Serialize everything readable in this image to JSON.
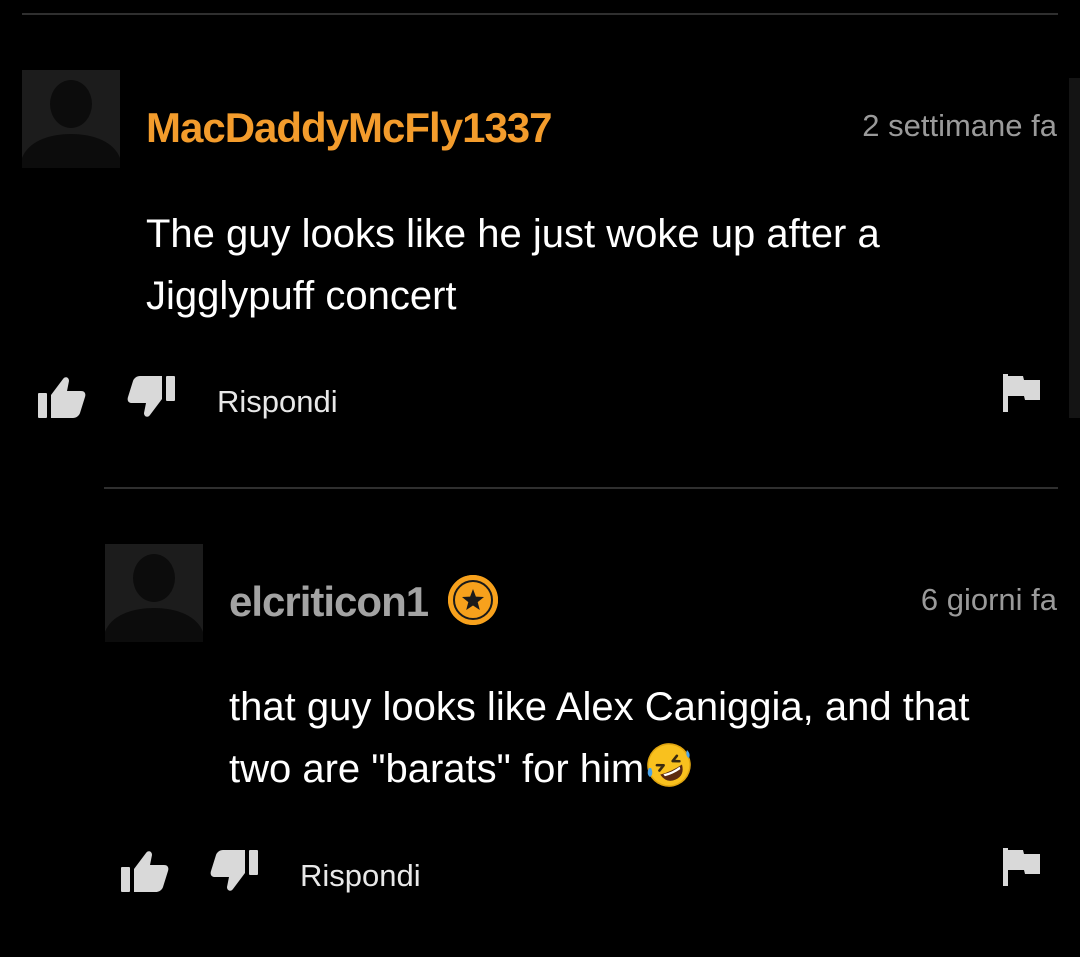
{
  "comments": [
    {
      "username": "MacDaddyMcFly1337",
      "timestamp": "2 settimane fa",
      "text": "The guy looks like he just woke up after a\nJigglypuff concert",
      "reply_label": "Rispondi",
      "has_badge": false
    },
    {
      "username": "elcriticon1",
      "timestamp": "6 giorni fa",
      "text": "that guy looks like Alex Caniggia, and that\ntwo are \"barats\" for him",
      "reply_label": "Rispondi",
      "has_badge": true,
      "badge_icon": "star-icon",
      "trailing_emoji": "rolling-on-floor-laughing-emoji"
    }
  ],
  "icons": {
    "like": "thumbs-up-icon",
    "dislike": "thumbs-down-icon",
    "report": "flag-icon",
    "avatar": "default-user-silhouette"
  },
  "colors": {
    "background": "#000000",
    "accent_username": "#f39c2c",
    "secondary_username": "#a3a3a3",
    "badge": "#f7a11c",
    "timestamp": "#9a9a9a",
    "icon": "#d9d9d9",
    "divider": "#2f2f2f"
  }
}
